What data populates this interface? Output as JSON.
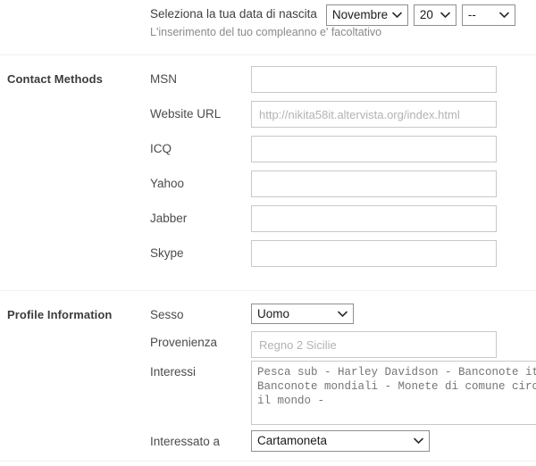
{
  "birthdate": {
    "prompt": "Seleziona la tua data di nascita",
    "note": "L'inserimento del tuo compleanno e' facoltativo",
    "month_value": "Novembre",
    "day_value": "20",
    "year_value": "--"
  },
  "contact": {
    "heading": "Contact Methods",
    "fields": [
      {
        "label": "MSN",
        "value": "",
        "placeholder": ""
      },
      {
        "label": "Website URL",
        "value": "",
        "placeholder": "http://nikita58it.altervista.org/index.html"
      },
      {
        "label": "ICQ",
        "value": "",
        "placeholder": ""
      },
      {
        "label": "Yahoo",
        "value": "",
        "placeholder": ""
      },
      {
        "label": "Jabber",
        "value": "",
        "placeholder": ""
      },
      {
        "label": "Skype",
        "value": "",
        "placeholder": ""
      }
    ]
  },
  "profile": {
    "heading": "Profile Information",
    "sesso_label": "Sesso",
    "sesso_value": "Uomo",
    "provenienza_label": "Provenienza",
    "provenienza_value": "",
    "provenienza_placeholder": "Regno 2 Sicilie",
    "interessi_label": "Interessi",
    "interessi_value": "",
    "interessi_placeholder": "Pesca sub - Harley Davidson - Banconote italiane -\nBanconote mondiali - Monete di comune circolazione in tutto\nil mondo -",
    "interessato_label": "Interessato a",
    "interessato_value": "Cartamoneta"
  },
  "colors": {
    "text": "#3f3f3f",
    "heading": "#3c3c3c",
    "placeholder": "#b3b3b3",
    "input_border": "#c8c8c8",
    "select_border": "#8f8f8f",
    "divider": "#f0f1f2"
  }
}
